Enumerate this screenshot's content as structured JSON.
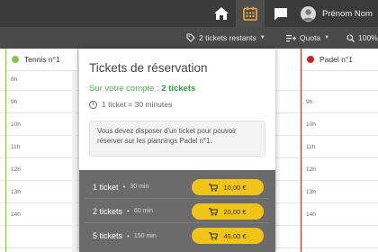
{
  "topbar": {
    "user_name": "Prénom Nom"
  },
  "toolbar": {
    "tickets_label": "2 tickets restants",
    "quota_label": "Quota",
    "zoom_label": "100%"
  },
  "columns": [
    {
      "name": "Tennis n°1",
      "color": "#8bc34a"
    },
    {
      "name": "Padel n°1",
      "color": "#c62828"
    }
  ],
  "hours_left": [
    "8h",
    "9h",
    "10h",
    "11h",
    "12h",
    "13h",
    "14h"
  ],
  "hours_right": [
    "9h",
    "10h",
    "11h",
    "12h",
    "13h",
    "14h"
  ],
  "popup": {
    "title": "Tickets de réservation",
    "account_prefix": "Sur votre compte : ",
    "account_count": "2 tickets",
    "info": "1 ticket = 30 minutes",
    "note": "Vous devez disposer d'un ticket pour pouvoir réserver sur les plannings Padel n°1.",
    "offers": [
      {
        "qty": "1 ticket",
        "duration": "30 min",
        "price": "10,00 €"
      },
      {
        "qty": "2 tickets",
        "duration": "60 min",
        "price": "20,00 €"
      },
      {
        "qty": "5 tickets",
        "duration": "150 min",
        "price": "45,00 €"
      }
    ]
  },
  "colors": {
    "accent": "#f0c419",
    "topbar": "#3b3b3b",
    "toolbar": "#4a4a4a",
    "calendar_icon": "#f2a93b",
    "account_green": "#2e9d3e"
  }
}
